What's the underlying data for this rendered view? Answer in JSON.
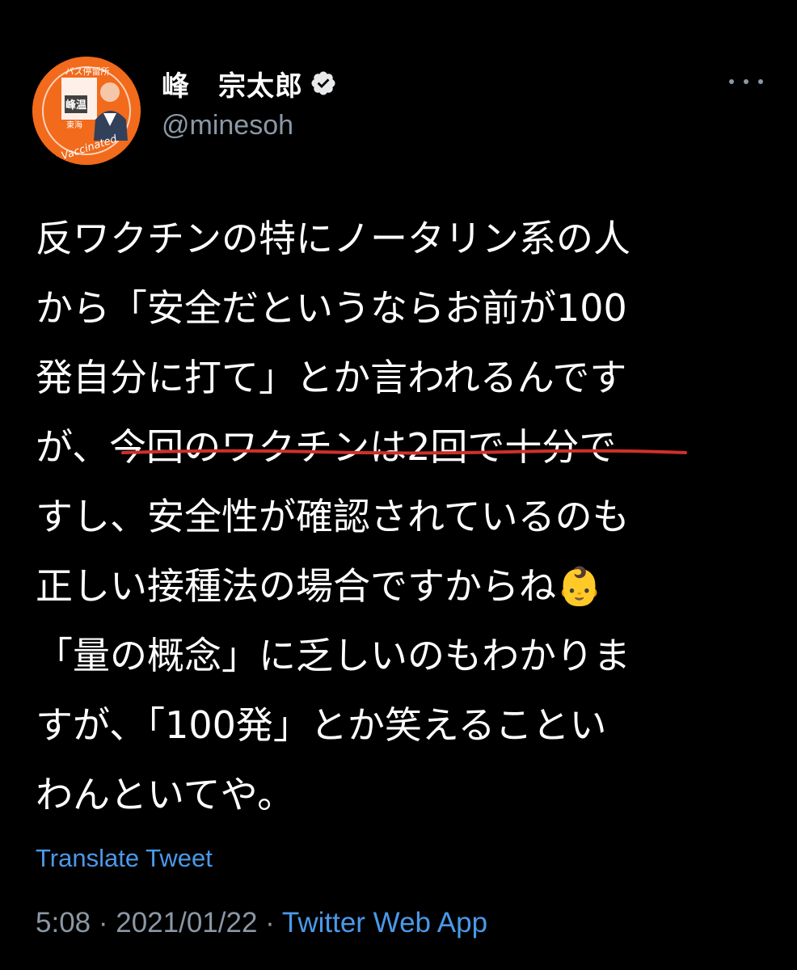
{
  "author": {
    "display_name": "峰　宗太郎",
    "handle": "@minesoh",
    "avatar": {
      "top_text": "バス停留所",
      "sign_text": "峰温",
      "badge_text": "I'm Vaccinated",
      "bottom_left_text": "東海"
    }
  },
  "tweet": {
    "lines": [
      "反ワクチンの特にノータリン系の人",
      "から「安全だというならお前が100",
      "発自分に打て」とか言われるんです",
      "が、今回のワクチンは2回で十分で",
      "すし、安全性が確認されているのも",
      "正しい接種法の場合ですからね👶",
      "「量の概念」に乏しいのもわかりま",
      "すが、「100発」とか笑えることい",
      "わんといてや。"
    ],
    "translate_label": "Translate Tweet",
    "time": "5:08",
    "separator": " · ",
    "date": "2021/01/22",
    "source": "Twitter Web App"
  },
  "colors": {
    "background": "#000000",
    "text": "#ffffff",
    "secondary": "#8b98a5",
    "link": "#4a99e9",
    "underline": "#d0302a",
    "avatar": "#f26a1b"
  },
  "icons": {
    "verified": "verified-badge-icon",
    "more": "more-horizontal-icon"
  }
}
